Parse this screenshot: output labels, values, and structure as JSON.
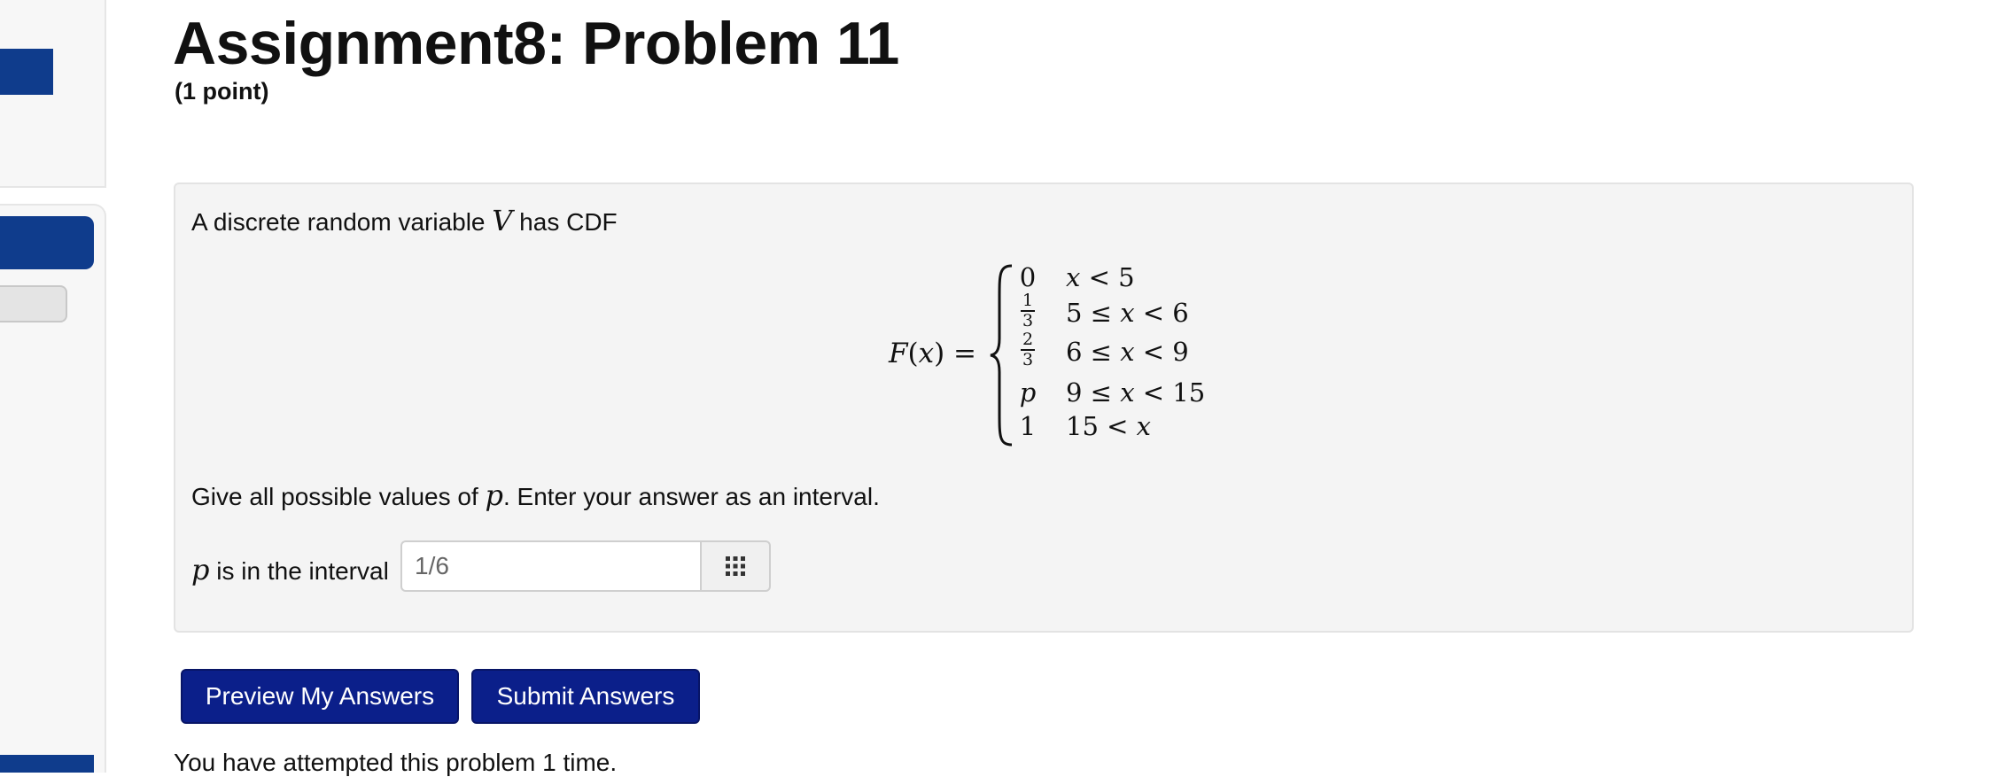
{
  "problem": {
    "title": "Assignment8: Problem 11",
    "points": "(1 point)",
    "intro_before": "A discrete random variable ",
    "intro_var": "V",
    "intro_after": " has CDF",
    "formula": {
      "lhs_fn": "F",
      "lhs_open": "(",
      "lhs_var": "x",
      "lhs_close": ") =",
      "cases": [
        {
          "value": "0",
          "condition_parts": [
            "",
            "x",
            " < 5"
          ]
        },
        {
          "value_num": "1",
          "value_den": "3",
          "condition_parts": [
            "5 ≤ ",
            "x",
            " < 6"
          ]
        },
        {
          "value_num": "2",
          "value_den": "3",
          "condition_parts": [
            "6 ≤ ",
            "x",
            " < 9"
          ]
        },
        {
          "value": "p",
          "condition_parts": [
            "9 ≤ ",
            "x",
            " < 15"
          ]
        },
        {
          "value": "1",
          "condition_parts": [
            "15 < ",
            "x",
            ""
          ]
        }
      ]
    },
    "instruction_before": "Give all possible values of ",
    "instruction_var": "p",
    "instruction_after": ". Enter your answer as an interval.",
    "answer_label_var": "p",
    "answer_label_text": " is in the interval",
    "answer_value": "1/6"
  },
  "buttons": {
    "preview": "Preview My Answers",
    "submit": "Submit Answers"
  },
  "attempts_text": "You have attempted this problem 1 time.",
  "icons": {
    "palette": "equation-palette-grid-icon"
  },
  "colors": {
    "primary_button": "#0b1f8a",
    "sidebar_accent": "#0f3c8c"
  }
}
